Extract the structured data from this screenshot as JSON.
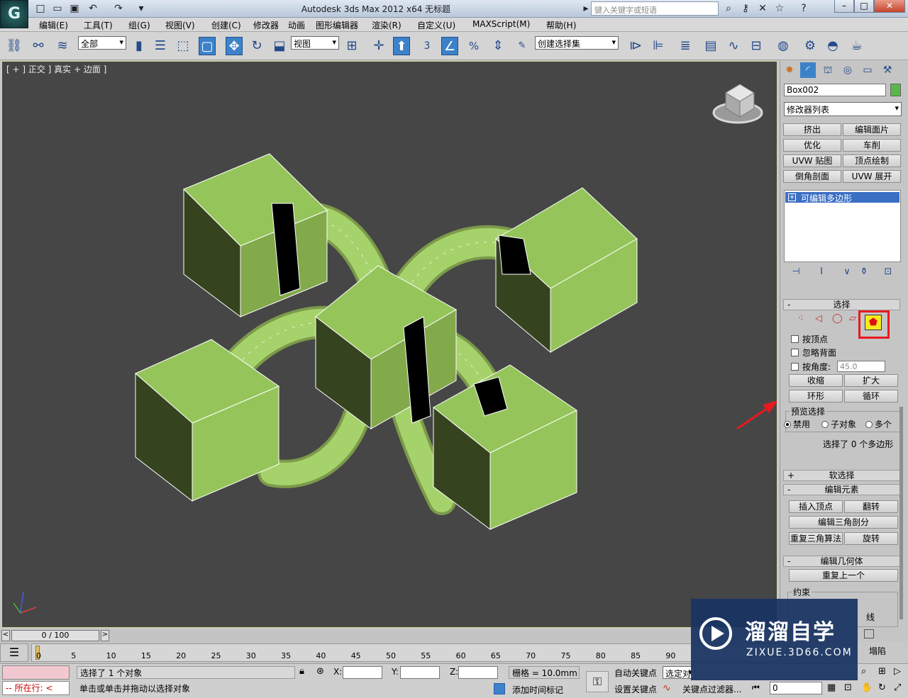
{
  "titlebar": {
    "title": "Autodesk 3ds Max  2012 x64      无标题",
    "search_placeholder": "键入关键字或短语"
  },
  "menu": [
    "编辑(E)",
    "工具(T)",
    "组(G)",
    "视图(V)",
    "创建(C)",
    "修改器",
    "动画",
    "图形编辑器",
    "渲染(R)",
    "自定义(U)",
    "MAXScript(M)",
    "帮助(H)"
  ],
  "toolbar": {
    "filter_value": "全部",
    "refcoord_value": "视图",
    "snap_label": "3",
    "selset_value": "创建选择集"
  },
  "viewport": {
    "label": "[ + ] 正交 ] 真实 + 边面 ]",
    "object_color": "#95c55a",
    "bg_color": "#464646"
  },
  "panel": {
    "object_name": "Box002",
    "object_color": "#58b848",
    "modifier_list": "修改器列表",
    "mod_buttons": [
      "挤出",
      "编辑面片",
      "优化",
      "车削",
      "UVW 贴图",
      "顶点绘制",
      "倒角剖面",
      "UVW 展开"
    ],
    "stack_item": "可编辑多边形",
    "selection": {
      "title": "选择",
      "by_vertex": "按顶点",
      "ignore_backfacing": "忽略背面",
      "by_angle": "按角度:",
      "angle_value": "45.0",
      "shrink": "收缩",
      "grow": "扩大",
      "ring": "环形",
      "loop": "循环",
      "preview_title": "预览选择",
      "preview_off": "禁用",
      "preview_sub": "子对象",
      "preview_multi": "多个",
      "status": "选择了 0 个多边形"
    },
    "soft_selection": "软选择",
    "edit_elements": {
      "title": "编辑元素",
      "insert_vertex": "插入顶点",
      "flip": "翻转",
      "edit_triangulation": "编辑三角剖分",
      "retriangulate": "重复三角算法",
      "turn": "旋转"
    },
    "edit_geometry": {
      "title": "编辑几何体",
      "repeat_last": "重复上一个",
      "constraints": "约束",
      "line_tail": "线",
      "collapse_tail": "塌陷"
    }
  },
  "trackbar": {
    "frame": "0 / 100",
    "ticks": [
      "0",
      "5",
      "10",
      "15",
      "20",
      "25",
      "30",
      "35",
      "40",
      "45",
      "50",
      "55",
      "60",
      "65",
      "70",
      "75",
      "80",
      "85",
      "90"
    ]
  },
  "status": {
    "selected": "选择了 1 个对象",
    "prompt": "单击或单击并拖动以选择对象",
    "where": "所在行:",
    "x_label": "X:",
    "y_label": "Y:",
    "z_label": "Z:",
    "grid": "栅格 = 10.0mm",
    "add_time_tag": "添加时间标记",
    "auto_key": "自动关键点",
    "set_key": "设置关键点",
    "selected_dd": "选定对",
    "key_filters": "关键点过滤器...",
    "frame_value": "0"
  },
  "watermark": {
    "name": "溜溜自学",
    "url": "ZIXUE.3D66.COM"
  }
}
